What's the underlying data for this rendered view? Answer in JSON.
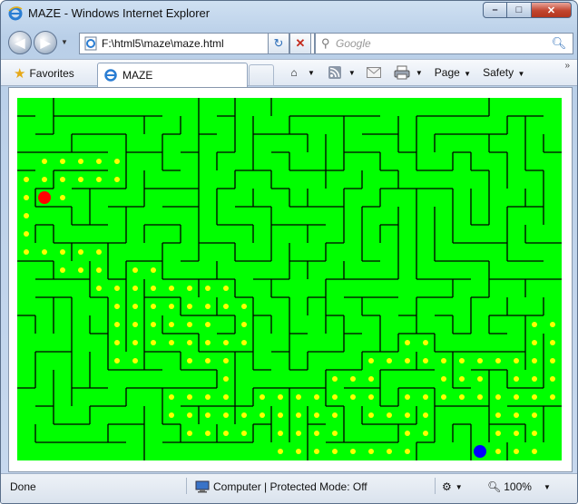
{
  "window": {
    "title": "MAZE - Windows Internet Explorer",
    "minimize_label": "–",
    "maximize_label": "□",
    "close_label": "✕"
  },
  "address": {
    "url": "F:\\html5\\maze\\maze.html",
    "search_placeholder": "Google"
  },
  "commandbar": {
    "favorites_label": "Favorites",
    "tab_label": "MAZE",
    "page_label": "Page",
    "safety_label": "Safety"
  },
  "maze": {
    "background_color": "#00ff00",
    "wall_color": "#000000",
    "dot_color": "#ffff00",
    "start_color": "#ff0000",
    "goal_color": "#0000ff"
  },
  "status": {
    "text": "Done",
    "zone": "Computer | Protected Mode: Off",
    "zoom": "100%"
  }
}
